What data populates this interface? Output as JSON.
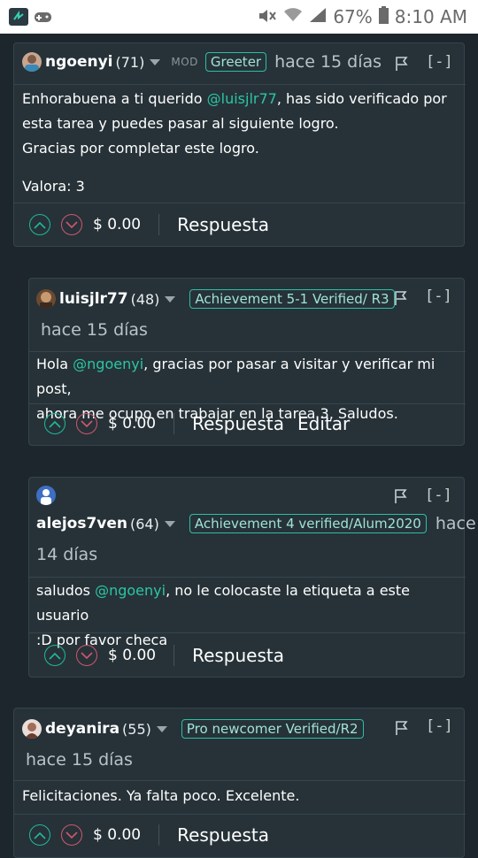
{
  "status_bar": {
    "battery": "67%",
    "time": "8:10 AM"
  },
  "comments": [
    {
      "user": "ngoenyi",
      "reputation": "(71)",
      "role": "MOD",
      "badge": "Greeter",
      "time": "hace 15 días",
      "collapse": "[-]",
      "body_p1_before": "Enhorabuena a ti querido ",
      "body_p1_mention": "@luisjlr77",
      "body_p1_after": ", has sido verificado por",
      "body_p1_line2": "esta tarea y puedes pasar al siguiente logro.",
      "body_p2": "Gracias por completar este logro.",
      "body_p3": "Valora: 3",
      "payout": "$ 0.00",
      "reply": "Respuesta"
    },
    {
      "user": "luisjlr77",
      "reputation": "(48)",
      "badge": "Achievement 5-1 Verified/ R3",
      "time": "hace 15 días",
      "collapse": "[-]",
      "body_l1_before": "Hola ",
      "body_l1_mention": "@ngoenyi",
      "body_l1_after": ", gracias por pasar a visitar y verificar mi post,",
      "body_l2": "ahora me ocupo en trabajar en la tarea 3, Saludos.",
      "payout": "$ 0.00",
      "reply": "Respuesta",
      "edit": "Editar"
    },
    {
      "user": "alejos7ven",
      "reputation": "(64)",
      "badge": "Achievement 4 verified/Alum2020",
      "time_part1": "hace",
      "time_part2": "14 días",
      "collapse": "[-]",
      "body_l1_before": "saludos ",
      "body_l1_mention": "@ngoenyi",
      "body_l1_after": ", no le colocaste la etiqueta a este usuario",
      "body_l2": ":D por favor checa",
      "payout": "$ 0.00",
      "reply": "Respuesta"
    },
    {
      "user": "deyanira",
      "reputation": "(55)",
      "badge": "Pro newcomer Verified/R2",
      "time": "hace 15 días",
      "collapse": "[-]",
      "body": "Felicitaciones. Ya falta poco. Excelente.",
      "payout": "$ 0.00",
      "reply": "Respuesta"
    }
  ],
  "colors": {
    "background": "#1d262c",
    "card": "#263238",
    "accent": "#2cc5a4",
    "upvote": "#21b99a",
    "downvote": "#d2566e"
  }
}
